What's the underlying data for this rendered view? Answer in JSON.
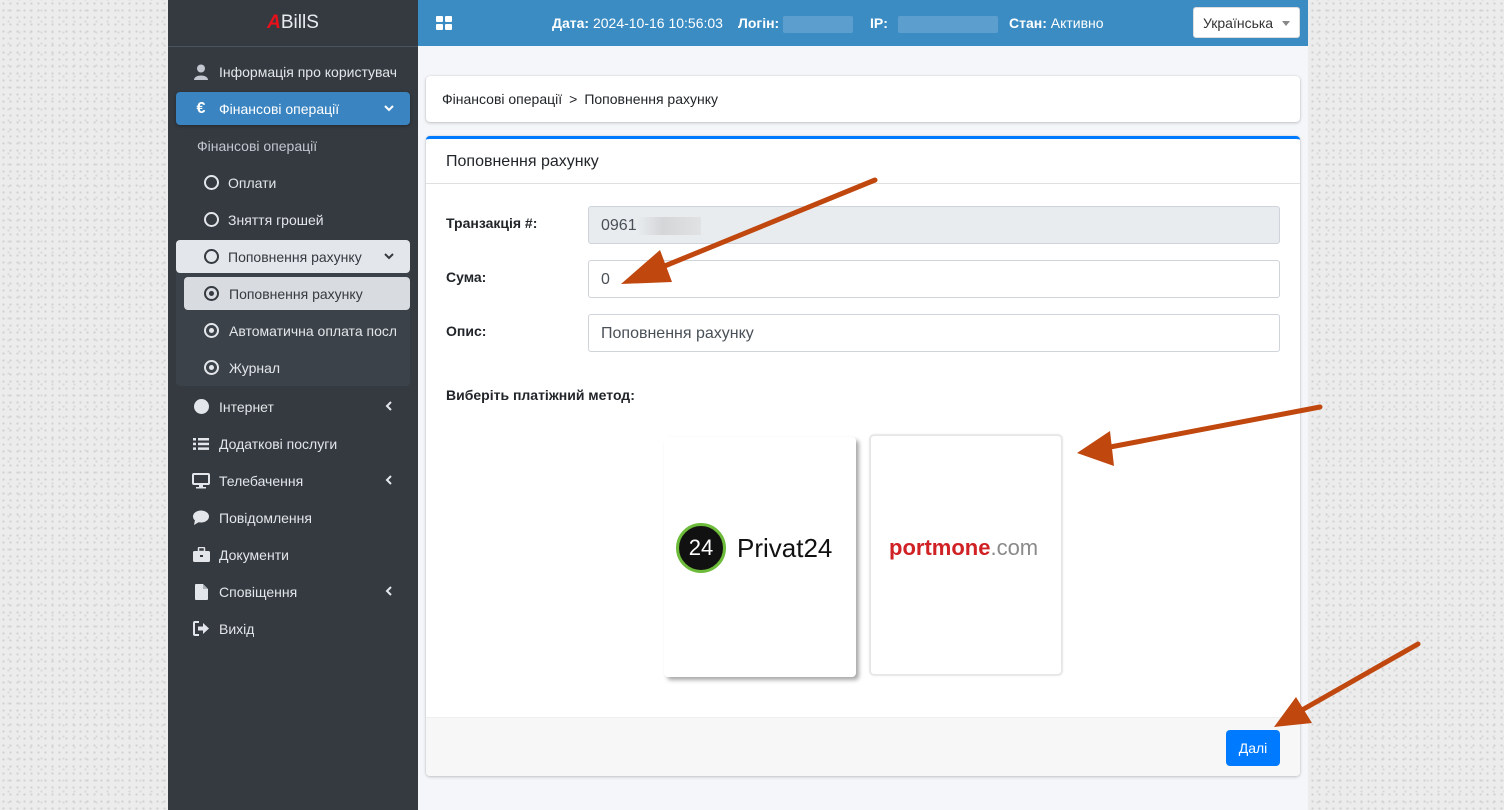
{
  "brand": {
    "first_letter": "A",
    "rest": "BillS"
  },
  "topbar": {
    "date_label": "Дата:",
    "date_value": "2024-10-16 10:56:03",
    "login_label": "Логін:",
    "ip_label": "IP:",
    "status_label": "Стан:",
    "status_value": "Активно",
    "language": "Українська"
  },
  "sidebar": {
    "user_info": "Інформація про користувача",
    "finance": "Фінансові операції",
    "finance_sub_title": "Фінансові операції",
    "payments": "Оплати",
    "withdrawals": "Зняття грошей",
    "topup": "Поповнення рахунку",
    "topup_sub": "Поповнення рахунку",
    "autopay": "Автоматична оплата послуг",
    "journal": "Журнал",
    "internet": "Інтернет",
    "extra_services": "Додаткові послуги",
    "tv": "Телебачення",
    "messages": "Повідомлення",
    "documents": "Документи",
    "notifications": "Сповіщення",
    "logout": "Вихід"
  },
  "breadcrumb": {
    "parent": "Фінансові операції",
    "separator": ">",
    "current": "Поповнення рахунку"
  },
  "form": {
    "title": "Поповнення рахунку",
    "transaction_label": "Транзакція #:",
    "transaction_value": "0961",
    "amount_label": "Сума:",
    "amount_value": "0",
    "description_label": "Опис:",
    "description_value": "Поповнення рахунку",
    "method_label": "Виберіть платіжний метод:",
    "methods": [
      {
        "badge": "24",
        "name": "Privat24"
      },
      {
        "name_main": "portmone",
        "name_suffix": ".com"
      }
    ],
    "next_button": "Далі"
  },
  "colors": {
    "sidebar_bg": "#343a40",
    "topbar_bg": "#3a8cc3",
    "active_item": "#3a85c1",
    "primary": "#007bff",
    "annotation_arrow": "#c0470e"
  }
}
